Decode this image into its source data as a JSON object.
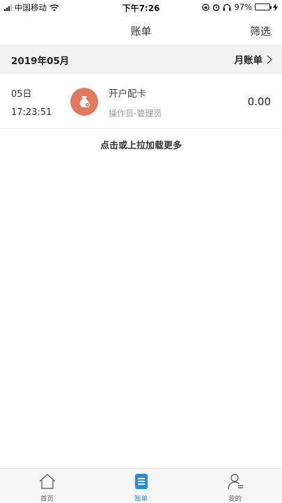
{
  "status_bar": {
    "carrier": "中国移动",
    "time": "下午7:26",
    "battery": "97%",
    "battery_level": 0.97,
    "icons": [
      "signal-icon",
      "wifi-icon",
      "lock-rotation-icon",
      "alarm-icon",
      "headphones-icon",
      "battery-icon",
      "charging-icon"
    ]
  },
  "nav": {
    "title": "账单",
    "filter_label": "筛选"
  },
  "month_header": {
    "month": "2019年05月",
    "bill_link": "月账单"
  },
  "bills": [
    {
      "date": "05日",
      "time": "17:23:51",
      "title": "开户配卡",
      "subtitle": "操作员-管理员",
      "amount": "0.00",
      "icon": "money-bag-icon",
      "icon_color": "#e07a5f"
    }
  ],
  "load_more": "点击或上拉加载更多",
  "tabs": [
    {
      "label": "首页",
      "icon": "home-icon",
      "active": false
    },
    {
      "label": "账单",
      "icon": "bill-icon",
      "active": true
    },
    {
      "label": "我的",
      "icon": "user-icon",
      "active": false
    }
  ],
  "colors": {
    "accent": "#2f8bd6",
    "header_bg": "#f2f2f2",
    "icon_bg": "#e07a5f"
  }
}
